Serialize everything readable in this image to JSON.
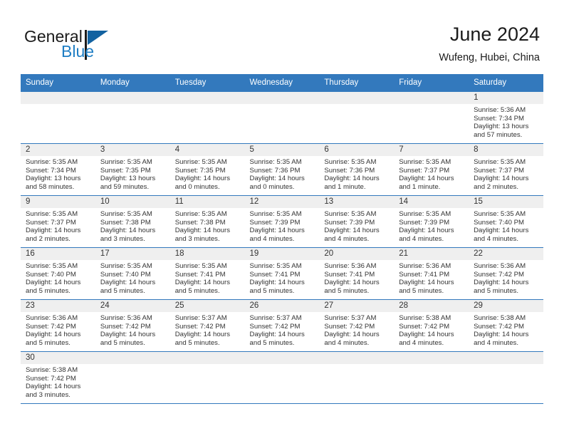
{
  "brand": {
    "name_part1": "General",
    "name_part2": "Blue",
    "accent_color": "#1f7ec4",
    "logo_triangle_color": "#1362a0"
  },
  "header": {
    "title": "June 2024",
    "location": "Wufeng, Hubei, China"
  },
  "theme": {
    "header_blue": "#3379bd",
    "daynum_band": "#efefef",
    "cell_background": "#ffffff",
    "text_color": "#333333"
  },
  "weekdays": [
    "Sunday",
    "Monday",
    "Tuesday",
    "Wednesday",
    "Thursday",
    "Friday",
    "Saturday"
  ],
  "weeks": [
    [
      {
        "blank": true
      },
      {
        "blank": true
      },
      {
        "blank": true
      },
      {
        "blank": true
      },
      {
        "blank": true
      },
      {
        "blank": true
      },
      {
        "day": "1",
        "sunrise": "Sunrise: 5:36 AM",
        "sunset": "Sunset: 7:34 PM",
        "daylight_line1": "Daylight: 13 hours",
        "daylight_line2": "and 57 minutes."
      }
    ],
    [
      {
        "day": "2",
        "sunrise": "Sunrise: 5:35 AM",
        "sunset": "Sunset: 7:34 PM",
        "daylight_line1": "Daylight: 13 hours",
        "daylight_line2": "and 58 minutes."
      },
      {
        "day": "3",
        "sunrise": "Sunrise: 5:35 AM",
        "sunset": "Sunset: 7:35 PM",
        "daylight_line1": "Daylight: 13 hours",
        "daylight_line2": "and 59 minutes."
      },
      {
        "day": "4",
        "sunrise": "Sunrise: 5:35 AM",
        "sunset": "Sunset: 7:35 PM",
        "daylight_line1": "Daylight: 14 hours",
        "daylight_line2": "and 0 minutes."
      },
      {
        "day": "5",
        "sunrise": "Sunrise: 5:35 AM",
        "sunset": "Sunset: 7:36 PM",
        "daylight_line1": "Daylight: 14 hours",
        "daylight_line2": "and 0 minutes."
      },
      {
        "day": "6",
        "sunrise": "Sunrise: 5:35 AM",
        "sunset": "Sunset: 7:36 PM",
        "daylight_line1": "Daylight: 14 hours",
        "daylight_line2": "and 1 minute."
      },
      {
        "day": "7",
        "sunrise": "Sunrise: 5:35 AM",
        "sunset": "Sunset: 7:37 PM",
        "daylight_line1": "Daylight: 14 hours",
        "daylight_line2": "and 1 minute."
      },
      {
        "day": "8",
        "sunrise": "Sunrise: 5:35 AM",
        "sunset": "Sunset: 7:37 PM",
        "daylight_line1": "Daylight: 14 hours",
        "daylight_line2": "and 2 minutes."
      }
    ],
    [
      {
        "day": "9",
        "sunrise": "Sunrise: 5:35 AM",
        "sunset": "Sunset: 7:37 PM",
        "daylight_line1": "Daylight: 14 hours",
        "daylight_line2": "and 2 minutes."
      },
      {
        "day": "10",
        "sunrise": "Sunrise: 5:35 AM",
        "sunset": "Sunset: 7:38 PM",
        "daylight_line1": "Daylight: 14 hours",
        "daylight_line2": "and 3 minutes."
      },
      {
        "day": "11",
        "sunrise": "Sunrise: 5:35 AM",
        "sunset": "Sunset: 7:38 PM",
        "daylight_line1": "Daylight: 14 hours",
        "daylight_line2": "and 3 minutes."
      },
      {
        "day": "12",
        "sunrise": "Sunrise: 5:35 AM",
        "sunset": "Sunset: 7:39 PM",
        "daylight_line1": "Daylight: 14 hours",
        "daylight_line2": "and 4 minutes."
      },
      {
        "day": "13",
        "sunrise": "Sunrise: 5:35 AM",
        "sunset": "Sunset: 7:39 PM",
        "daylight_line1": "Daylight: 14 hours",
        "daylight_line2": "and 4 minutes."
      },
      {
        "day": "14",
        "sunrise": "Sunrise: 5:35 AM",
        "sunset": "Sunset: 7:39 PM",
        "daylight_line1": "Daylight: 14 hours",
        "daylight_line2": "and 4 minutes."
      },
      {
        "day": "15",
        "sunrise": "Sunrise: 5:35 AM",
        "sunset": "Sunset: 7:40 PM",
        "daylight_line1": "Daylight: 14 hours",
        "daylight_line2": "and 4 minutes."
      }
    ],
    [
      {
        "day": "16",
        "sunrise": "Sunrise: 5:35 AM",
        "sunset": "Sunset: 7:40 PM",
        "daylight_line1": "Daylight: 14 hours",
        "daylight_line2": "and 5 minutes."
      },
      {
        "day": "17",
        "sunrise": "Sunrise: 5:35 AM",
        "sunset": "Sunset: 7:40 PM",
        "daylight_line1": "Daylight: 14 hours",
        "daylight_line2": "and 5 minutes."
      },
      {
        "day": "18",
        "sunrise": "Sunrise: 5:35 AM",
        "sunset": "Sunset: 7:41 PM",
        "daylight_line1": "Daylight: 14 hours",
        "daylight_line2": "and 5 minutes."
      },
      {
        "day": "19",
        "sunrise": "Sunrise: 5:35 AM",
        "sunset": "Sunset: 7:41 PM",
        "daylight_line1": "Daylight: 14 hours",
        "daylight_line2": "and 5 minutes."
      },
      {
        "day": "20",
        "sunrise": "Sunrise: 5:36 AM",
        "sunset": "Sunset: 7:41 PM",
        "daylight_line1": "Daylight: 14 hours",
        "daylight_line2": "and 5 minutes."
      },
      {
        "day": "21",
        "sunrise": "Sunrise: 5:36 AM",
        "sunset": "Sunset: 7:41 PM",
        "daylight_line1": "Daylight: 14 hours",
        "daylight_line2": "and 5 minutes."
      },
      {
        "day": "22",
        "sunrise": "Sunrise: 5:36 AM",
        "sunset": "Sunset: 7:42 PM",
        "daylight_line1": "Daylight: 14 hours",
        "daylight_line2": "and 5 minutes."
      }
    ],
    [
      {
        "day": "23",
        "sunrise": "Sunrise: 5:36 AM",
        "sunset": "Sunset: 7:42 PM",
        "daylight_line1": "Daylight: 14 hours",
        "daylight_line2": "and 5 minutes."
      },
      {
        "day": "24",
        "sunrise": "Sunrise: 5:36 AM",
        "sunset": "Sunset: 7:42 PM",
        "daylight_line1": "Daylight: 14 hours",
        "daylight_line2": "and 5 minutes."
      },
      {
        "day": "25",
        "sunrise": "Sunrise: 5:37 AM",
        "sunset": "Sunset: 7:42 PM",
        "daylight_line1": "Daylight: 14 hours",
        "daylight_line2": "and 5 minutes."
      },
      {
        "day": "26",
        "sunrise": "Sunrise: 5:37 AM",
        "sunset": "Sunset: 7:42 PM",
        "daylight_line1": "Daylight: 14 hours",
        "daylight_line2": "and 5 minutes."
      },
      {
        "day": "27",
        "sunrise": "Sunrise: 5:37 AM",
        "sunset": "Sunset: 7:42 PM",
        "daylight_line1": "Daylight: 14 hours",
        "daylight_line2": "and 4 minutes."
      },
      {
        "day": "28",
        "sunrise": "Sunrise: 5:38 AM",
        "sunset": "Sunset: 7:42 PM",
        "daylight_line1": "Daylight: 14 hours",
        "daylight_line2": "and 4 minutes."
      },
      {
        "day": "29",
        "sunrise": "Sunrise: 5:38 AM",
        "sunset": "Sunset: 7:42 PM",
        "daylight_line1": "Daylight: 14 hours",
        "daylight_line2": "and 4 minutes."
      }
    ],
    [
      {
        "day": "30",
        "sunrise": "Sunrise: 5:38 AM",
        "sunset": "Sunset: 7:42 PM",
        "daylight_line1": "Daylight: 14 hours",
        "daylight_line2": "and 3 minutes."
      },
      {
        "blank": true
      },
      {
        "blank": true
      },
      {
        "blank": true
      },
      {
        "blank": true
      },
      {
        "blank": true
      },
      {
        "blank": true
      }
    ]
  ]
}
